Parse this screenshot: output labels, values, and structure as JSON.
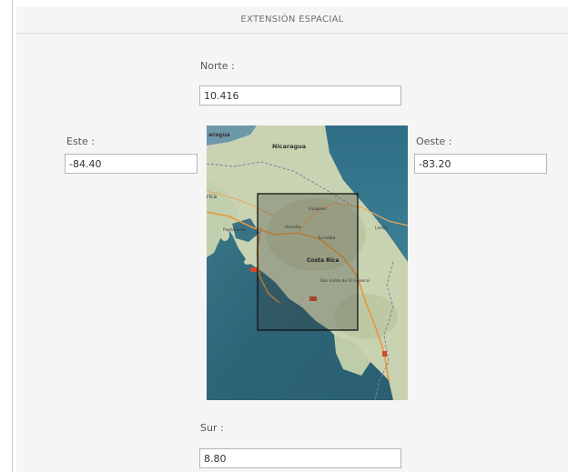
{
  "panel": {
    "title": "EXTENSIÓN ESPACIAL"
  },
  "fields": {
    "norte": {
      "label": "Norte :",
      "value": "10.416"
    },
    "este": {
      "label": "Este :",
      "value": "-84.40"
    },
    "oeste": {
      "label": "Oeste :",
      "value": "-83.20"
    },
    "sur": {
      "label": "Sur :",
      "value": "8.80"
    }
  },
  "map": {
    "labels": {
      "nicaragua": "Nicaragua",
      "costa_rica": "Costa Rica",
      "guapiles": "Guápiles",
      "heredia": "Heredia",
      "turrialba": "Turrialba",
      "puntarenas": "Puntarenas",
      "limon": "Limón",
      "san_isidro": "San Isidro de El General",
      "edge_top": "aragua",
      "edge_left": "rica"
    },
    "colors": {
      "sea": "#2f6c7e",
      "land": "#c8d2b4",
      "road": "#e89a3c",
      "selection_fill": "#3a3a3a",
      "selection_stroke": "#111111"
    }
  }
}
